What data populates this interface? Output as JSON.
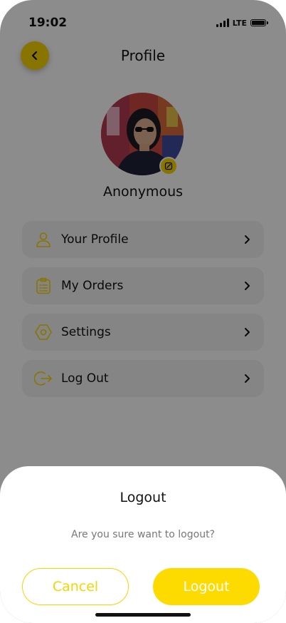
{
  "status": {
    "time": "19:02",
    "network": "LTE",
    "signal_icon": "signal-bars-icon",
    "battery_icon": "battery-icon"
  },
  "header": {
    "title": "Profile",
    "back_icon": "chevron-left-icon"
  },
  "profile": {
    "name": "Anonymous",
    "edit_icon": "edit-icon"
  },
  "menu": {
    "items": [
      {
        "label": "Your Profile",
        "icon": "user-icon"
      },
      {
        "label": "My Orders",
        "icon": "clipboard-list-icon"
      },
      {
        "label": "Settings",
        "icon": "gear-icon"
      },
      {
        "label": "Log Out",
        "icon": "logout-icon"
      }
    ],
    "chevron_icon": "chevron-right-icon"
  },
  "dialog": {
    "title": "Logout",
    "message": "Are you sure want to logout?",
    "cancel_label": "Cancel",
    "confirm_label": "Logout"
  },
  "colors": {
    "accent": "#F8D400",
    "overlay": "#000000"
  }
}
